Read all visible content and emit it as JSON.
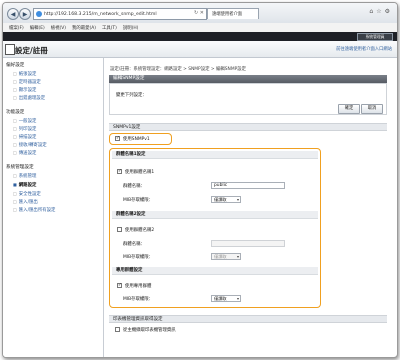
{
  "browser": {
    "url": "http://192.168.3.215/m_network_snmp_edit.html",
    "tab_label": "遠端使用者介面",
    "menu": [
      "檔案(F)",
      "編輯(E)",
      "檢視(V)",
      "我的最愛(A)",
      "工具(T)",
      "說明(H)"
    ]
  },
  "app": {
    "device_name": "",
    "login_user_button": "系統管理員",
    "title": "設定/註冊",
    "to_portal_link": "前往遠端使用者介面入口網站"
  },
  "sidebar": {
    "sections": [
      {
        "label": "偏好設定",
        "items": [
          "紙張設定",
          "定時器設定",
          "顯示設定",
          "出錯處理設定"
        ]
      },
      {
        "label": "功能設定",
        "items": [
          "一般設定",
          "列印設定",
          "掃描設定",
          "接收/轉寄設定",
          "傳送設定"
        ]
      },
      {
        "label": "系統管理設定",
        "items": [
          "系統管理",
          "網路設定",
          "安全性設定",
          "匯入/匯出",
          "匯入/匯出所有設定"
        ]
      }
    ],
    "active_item": "網路設定"
  },
  "main": {
    "breadcrumb": "設定/註冊：系統管理設定：網路設定 > SNMP設定 > 編輯SNMP設定",
    "panel_title": "編輯SNMP設定",
    "changes_text": "變更下列設定：",
    "ok_button": "確定",
    "cancel_button": "取消",
    "snmpv1_section": "SNMPv1設定",
    "use_snmpv1_label": "使用SNMPv1",
    "community_settings": "群體名稱設定",
    "community1": {
      "header": "群體名稱1設定",
      "use_label": "使用群體名稱1",
      "name_label": "群體名稱：",
      "name_value": "public",
      "mib_label": "MIB存取權限：",
      "mib_value": "僅讀取"
    },
    "community2": {
      "header": "群體名稱2設定",
      "use_label": "使用群體名稱2",
      "name_label": "群體名稱：",
      "name_value": "",
      "mib_label": "MIB存取權限：",
      "mib_value": "僅讀取"
    },
    "dedicated": {
      "header": "專用群體設定",
      "use_label": "使用專用群體",
      "mib_label": "MIB存取權限：",
      "mib_value": "僅讀取"
    },
    "printer_mgmt_section": "印表機管理資訊取得設定",
    "printer_mgmt_label": "從主機擷取印表機管理資訊"
  },
  "colors": {
    "highlight": "#f0a020",
    "link": "#2f5f9e",
    "section_bar": "#5f656d"
  }
}
